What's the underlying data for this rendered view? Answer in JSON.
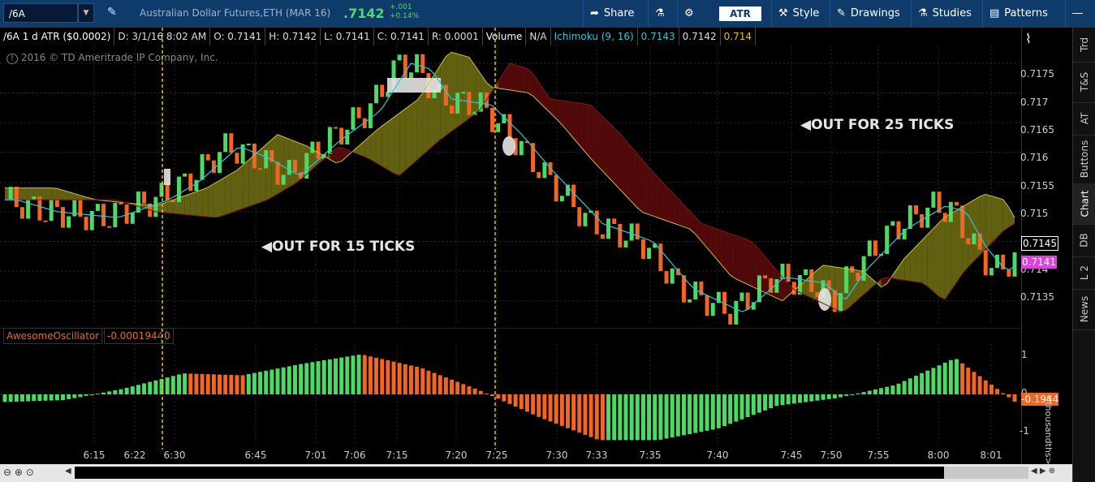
{
  "topbar": {
    "symbol": "/6A",
    "instrument": "Australian Dollar Futures,ETH (MAR 16)",
    "last_price": ".7142",
    "change": "+.001",
    "change_pct": "+0.14%",
    "share_label": "Share",
    "atr_label": "ATR",
    "style_label": "Style",
    "drawings_label": "Drawings",
    "studies_label": "Studies",
    "patterns_label": "Patterns"
  },
  "infobar": {
    "title": "/6A 1 d ATR ($0.0002)",
    "date": "D: 3/1/16 8:02 AM",
    "open": "O: 0.7141",
    "high": "H: 0.7142",
    "low": "L: 0.7141",
    "close": "C: 0.7141",
    "range": "R: 0.0001",
    "volume_label": "Volume",
    "volume_value": "N/A",
    "ichimoku_label": "Ichimoku (9, 16)",
    "ichimoku_value": "0.7143",
    "ichimoku_v2": "0.7142",
    "ichimoku_v3": "0.714"
  },
  "copyright": "2016 © TD Ameritrade IP Company, Inc.",
  "sidebar": {
    "items": [
      "Trd",
      "T&S",
      "AT",
      "Buttons",
      "Chart",
      "DB",
      "L 2",
      "News"
    ]
  },
  "annotations": {
    "out15": "OUT FOR 15 TICKS",
    "out25": "OUT FOR 25 TICKS"
  },
  "price_axis": {
    "labels": [
      "0.7175",
      "0.717",
      "0.7165",
      "0.716",
      "0.7155",
      "0.715",
      "0.714",
      "0.7135"
    ],
    "current_price": "0.7141",
    "reference_price": "0.7145"
  },
  "oscillator": {
    "name": "AwesomeOscillator",
    "value": "-0.0001944",
    "zero_label": "0",
    "axis_labels": [
      "1",
      "0",
      "-1"
    ],
    "current_value": "-0.1944",
    "unit": "<thousandths>"
  },
  "time_axis": {
    "labels": [
      "6:15",
      "6:22",
      "6:30",
      "6:45",
      "7:01",
      "7:06",
      "7:15",
      "7:20",
      "7:25",
      "7:30",
      "7:33",
      "7:35",
      "7:40",
      "7:45",
      "7:50",
      "7:55",
      "8:00",
      "8:01"
    ]
  },
  "colors": {
    "up": "#4cd964",
    "down": "#f26522",
    "topbar": "#0f3b6b",
    "tenkan": "#2ec8d8",
    "cloud_bull": "#6b6a13",
    "cloud_bear": "#5a0a0a",
    "current_price_bg": "#e040e0",
    "vline": "#e6c200"
  },
  "chart_data": [
    {
      "type": "line",
      "title": "/6A 1 d ATR ($0.0002)",
      "xlabel": "",
      "ylabel": "",
      "ylim": [
        0.7131,
        0.7178
      ],
      "x": [
        "6:15",
        "6:22",
        "6:30",
        "6:45",
        "7:01",
        "7:06",
        "7:15",
        "7:20",
        "7:25",
        "7:30",
        "7:33",
        "7:35",
        "7:40",
        "7:45",
        "7:50",
        "7:55",
        "8:00",
        "8:01"
      ],
      "series": [
        {
          "name": "Ichimoku (9, 16)",
          "values": [
            0.715,
            0.7151,
            0.7154,
            0.7159,
            0.7163,
            0.7169,
            0.7175,
            0.7169,
            0.7165,
            0.7156,
            0.715,
            0.7147,
            0.7137,
            0.714,
            0.7136,
            0.7145,
            0.7151,
            0.7142
          ]
        }
      ],
      "grid": true
    },
    {
      "type": "bar",
      "title": "AwesomeOscillator",
      "ylim": [
        -1.2,
        1.2
      ],
      "x": [
        "6:15",
        "6:22",
        "6:30",
        "6:45",
        "7:01",
        "7:06",
        "7:15",
        "7:20",
        "7:25",
        "7:30",
        "7:33",
        "7:35",
        "7:40",
        "7:45",
        "7:50",
        "7:55",
        "8:00",
        "8:01"
      ],
      "values": [
        -0.2,
        -0.15,
        0.15,
        0.55,
        0.5,
        0.8,
        1.05,
        0.7,
        0.1,
        -0.6,
        -1.2,
        -1.2,
        -0.9,
        -0.3,
        -0.1,
        0.25,
        0.95,
        -0.19
      ]
    }
  ]
}
